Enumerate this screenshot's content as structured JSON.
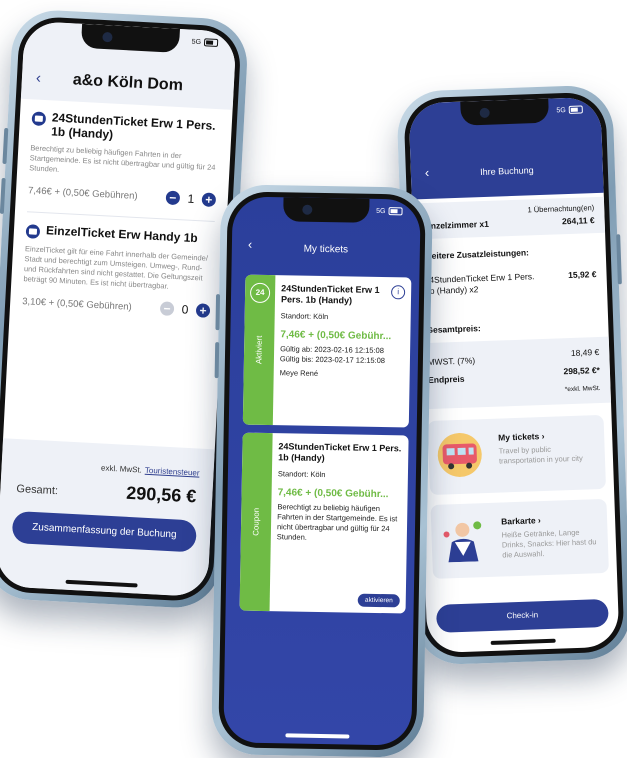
{
  "status": {
    "network": "5G"
  },
  "booking": {
    "title": "a&o Köln Dom",
    "tickets": [
      {
        "name": "24StundenTicket Erw 1 Pers. 1b (Handy)",
        "desc": "Berechtigt zu beliebig häufigen Fahrten in der Startgemeinde. Es ist nicht übertragbar und gültig für 24 Stunden.",
        "price": "7,46€ + (0,50€ Gebühren)",
        "qty": "1"
      },
      {
        "name": "EinzelTicket Erw Handy 1b",
        "desc": "EinzelTicket gilt für eine Fahrt innerhalb der Gemeinde/ Stadt und berechtigt zum Umsteigen. Umweg-, Rund- und Rückfahrten sind nicht gestattet. Die Geltungszeit beträgt 90 Minuten. Es ist nicht übertragbar.",
        "price": "3,10€ + (0,50€ Gebühren)",
        "qty": "0"
      }
    ],
    "tax_note": "exkl. MwSt.",
    "tax_link": "Touristensteuer",
    "total_label": "Gesamt:",
    "total_value": "290,56 €",
    "cta": "Zusammenfassung der Buchung"
  },
  "mytickets": {
    "title": "My tickets",
    "cards": [
      {
        "badge": "24",
        "status": "Aktiviert",
        "name": "24StundenTicket Erw 1 Pers. 1b (Handy)",
        "location": "Standort: Köln",
        "price": "7,46€ + (0,50€ Gebühr...",
        "valid_from": "Gültig ab: 2023-02-16 12:15:08",
        "valid_to": "Gültig bis: 2023-02-17 12:15:08",
        "owner": "Meye René"
      },
      {
        "status": "Coupon",
        "name": "24StundenTicket Erw 1 Pers. 1b (Handy)",
        "location": "Standort: Köln",
        "price": "7,46€ + (0,50€ Gebühr...",
        "desc": "Berechtigt zu beliebig häufigen Fahrten in der Startgemeinde. Es ist nicht übertragbar und gültig für 24 Stunden.",
        "action": "aktivieren"
      }
    ]
  },
  "ihre_buchung": {
    "title": "Ihre Buchung",
    "room_label": "Einzelzimmer x1",
    "room_nights": "1 Übernachtung(en)",
    "room_price": "264,11 €",
    "extras_label": "Weitere Zusatzleistungen:",
    "extra_item": "24StundenTicket Erw 1 Pers. 1b (Handy) x2",
    "extra_price": "15,92 €",
    "total_heading": "Gesamtpreis:",
    "mwst_label": "MWST. (7%)",
    "mwst_value": "18,49 €",
    "end_label": "Endpreis",
    "end_value": "298,52 €*",
    "end_note": "*exkl. MwSt.",
    "promos": [
      {
        "title": "My tickets",
        "text": "Travel by public transportation in your city"
      },
      {
        "title": "Barkarte",
        "text": "Heiße Getränke, Lange Drinks, Snacks: Hier hast du die Auswahl."
      }
    ],
    "checkin": "Check-in"
  },
  "colors": {
    "primary": "#2d3f95",
    "green": "#6fbb45",
    "panel": "#eef1f7"
  }
}
